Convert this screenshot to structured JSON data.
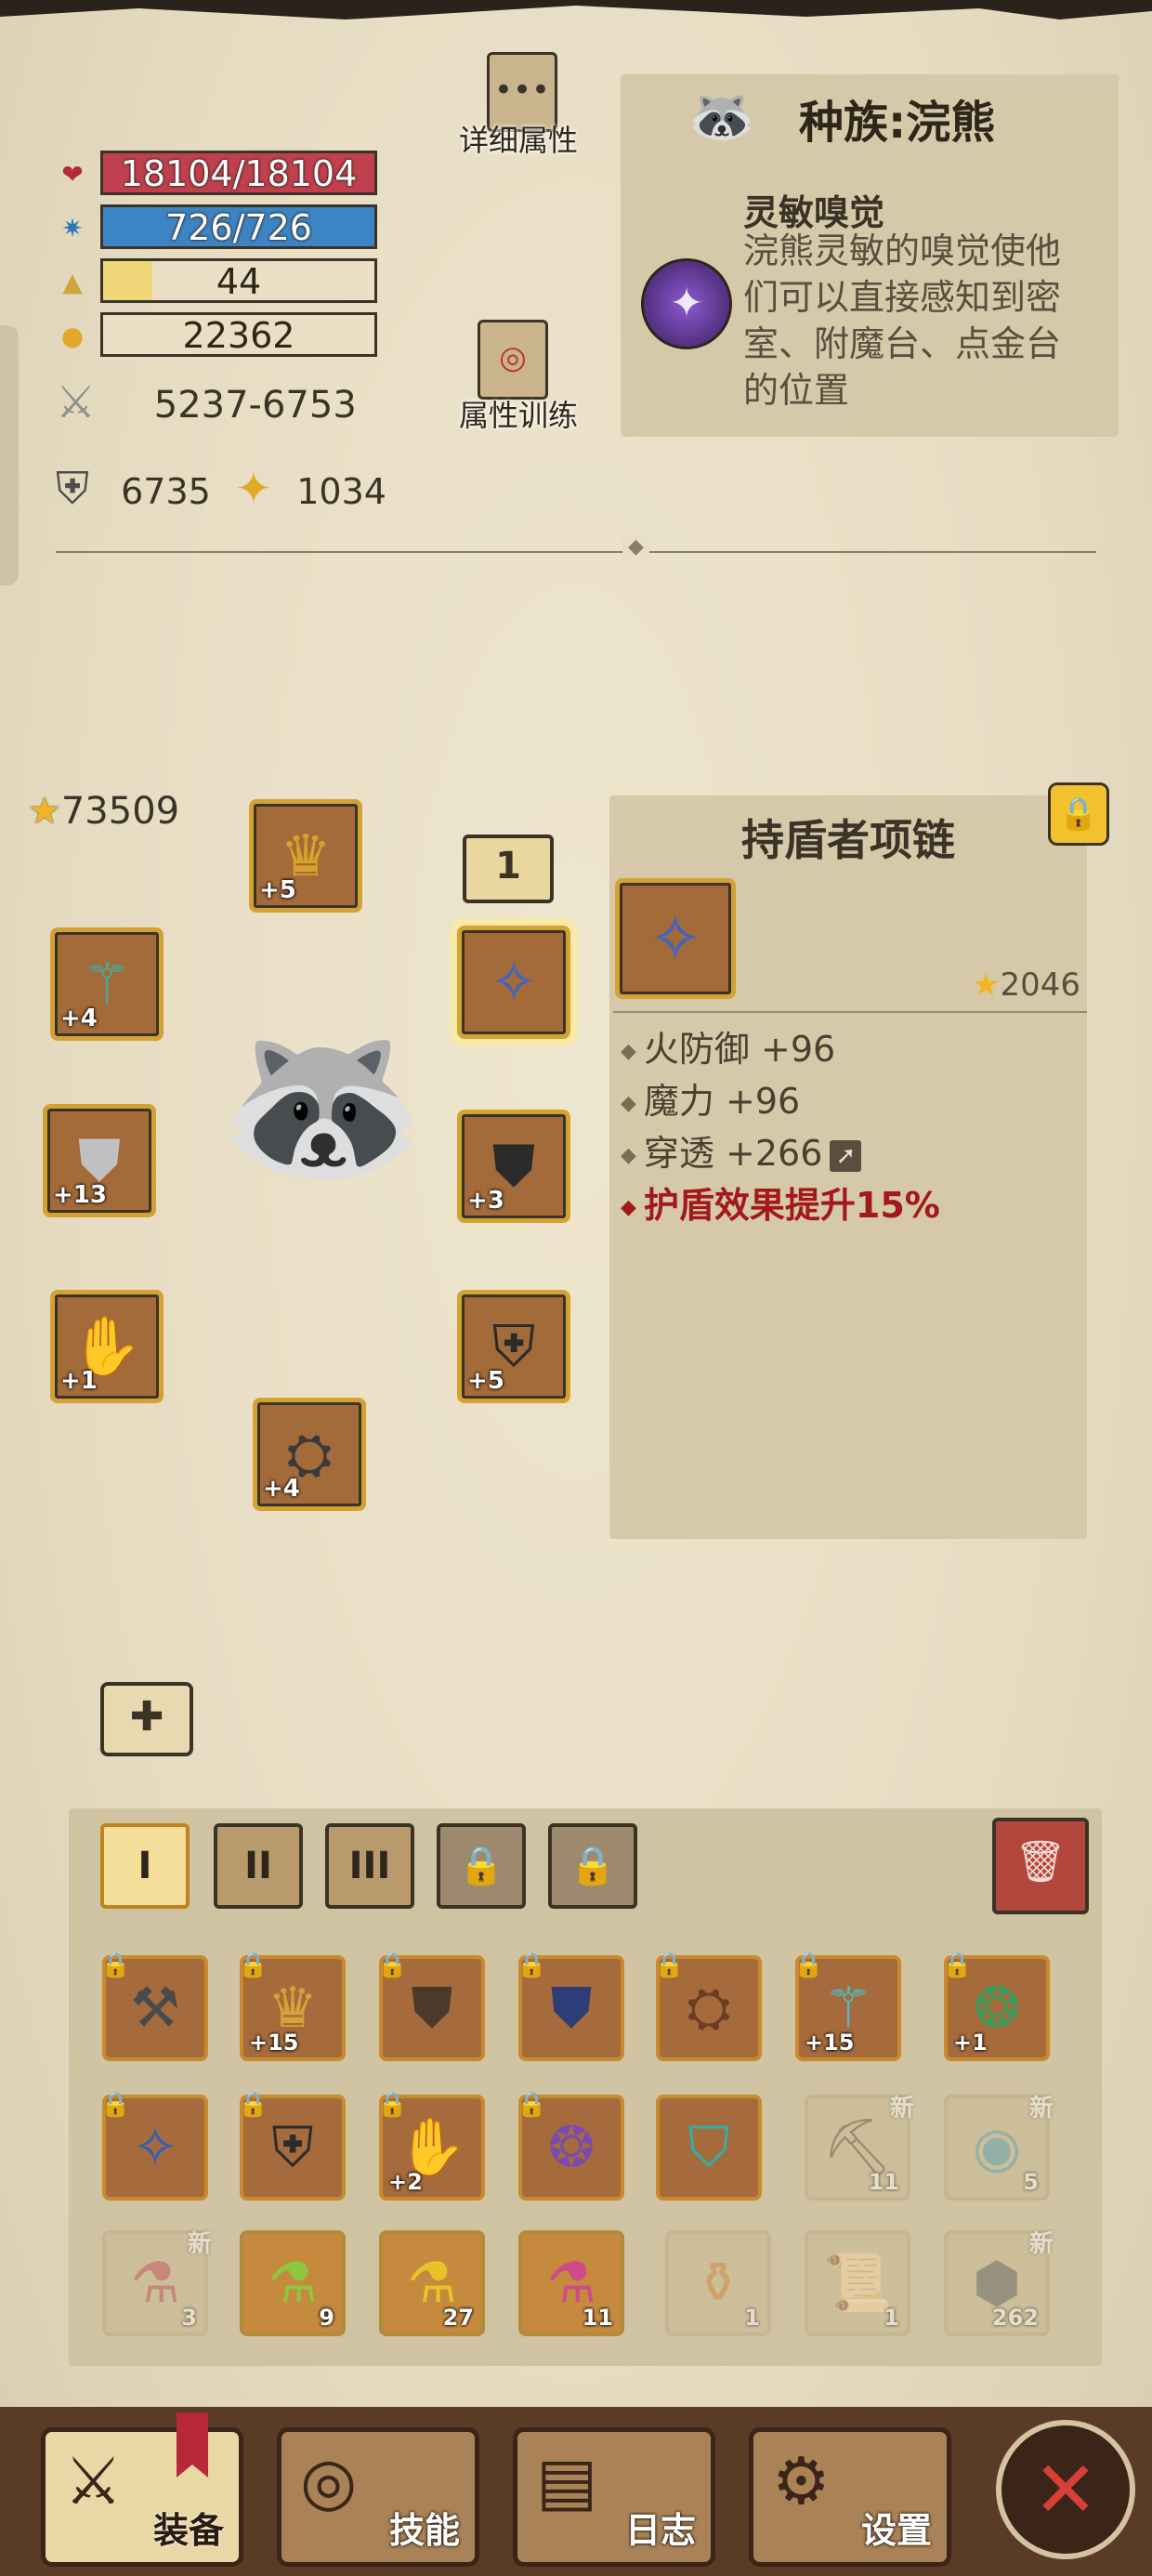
{
  "stats": {
    "hp": "18104/18104",
    "mp": "726/726",
    "level": "44",
    "gold": "22362",
    "attack": "5237-6753",
    "armor": "6735",
    "magic_resist": "1034",
    "hp_fill": 1.0,
    "mp_fill": 1.0,
    "level_fill": 0.18
  },
  "buttons": {
    "detail_attributes": "详细属性",
    "attribute_training": "属性训练"
  },
  "race": {
    "title": "种族:浣熊",
    "trait_name": "灵敏嗅觉",
    "trait_desc": "浣熊灵敏的嗅觉使他们可以直接感知到密室、附魔台、点金台的位置"
  },
  "equipment": {
    "total_score": "73509",
    "set_number": "1",
    "slots": [
      {
        "name": "helmet",
        "level": "+5"
      },
      {
        "name": "weapon",
        "level": "+4"
      },
      {
        "name": "necklace",
        "level": ""
      },
      {
        "name": "shoulder",
        "level": "+13"
      },
      {
        "name": "chest",
        "level": "+3"
      },
      {
        "name": "gloves",
        "level": "+1"
      },
      {
        "name": "belt",
        "level": "+5"
      },
      {
        "name": "boots",
        "level": "+4"
      }
    ]
  },
  "detail": {
    "title": "持盾者项链",
    "score": "2046",
    "attributes": [
      "火防御 +96",
      "魔力 +96",
      "穿透 +266"
    ],
    "special": "护盾效果提升15%"
  },
  "inventory": {
    "tabs": [
      "I",
      "II",
      "III"
    ],
    "row1": [
      {
        "lvl": "",
        "locked": true
      },
      {
        "lvl": "+15",
        "locked": true
      },
      {
        "lvl": "",
        "locked": true
      },
      {
        "lvl": "",
        "locked": true
      },
      {
        "lvl": "",
        "locked": true
      },
      {
        "lvl": "+15",
        "locked": true
      },
      {
        "lvl": "+1",
        "locked": true
      }
    ],
    "row2": [
      {
        "lvl": "",
        "locked": true
      },
      {
        "lvl": "",
        "locked": true
      },
      {
        "lvl": "+2",
        "locked": true
      },
      {
        "lvl": "",
        "locked": true
      },
      {
        "lvl": "",
        "locked": false
      },
      {
        "cnt": "11",
        "new": "新"
      },
      {
        "cnt": "5",
        "new": "新"
      }
    ],
    "row3": [
      {
        "cnt": "3",
        "new": "新"
      },
      {
        "cnt": "9"
      },
      {
        "cnt": "27"
      },
      {
        "cnt": "11"
      },
      {
        "cnt": "1"
      },
      {
        "cnt": "1"
      },
      {
        "cnt": "262",
        "new": "新"
      }
    ]
  },
  "nav": {
    "equipment": "装备",
    "skills": "技能",
    "log": "日志",
    "settings": "设置"
  }
}
